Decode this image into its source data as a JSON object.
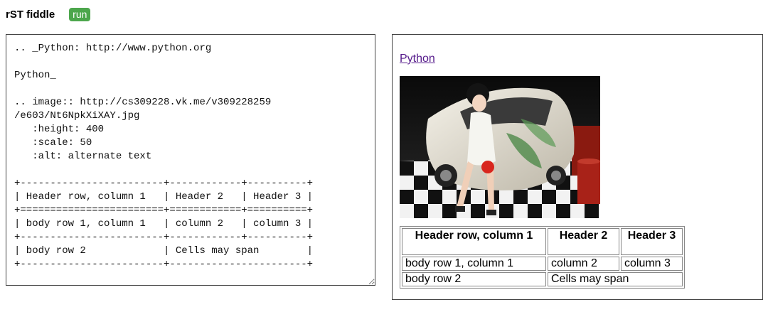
{
  "header": {
    "title": "rST fiddle",
    "run_label": "run"
  },
  "editor": {
    "source": ".. _Python: http://www.python.org\n\nPython_\n\n.. image:: http://cs309228.vk.me/v309228259\n/e603/Nt6NpkXiXAY.jpg\n   :height: 400\n   :scale: 50\n   :alt: alternate text\n\n+------------------------+------------+----------+\n| Header row, column 1   | Header 2   | Header 3 |\n+========================+============+==========+\n| body row 1, column 1   | column 2   | column 3 |\n+------------------------+------------+----------+\n| body row 2             | Cells may span        |\n+------------------------+-----------------------+"
  },
  "preview": {
    "link_text": "Python",
    "image_alt": "alternate text",
    "table": {
      "headers": [
        "Header row, column 1",
        "Header 2",
        "Header 3"
      ],
      "row1": [
        "body row 1, column 1",
        "column 2",
        "column 3"
      ],
      "row2": [
        "body row 2",
        "Cells may span"
      ]
    }
  },
  "colors": {
    "run_button": "#4ca64c",
    "visited_link": "#551a8b"
  }
}
